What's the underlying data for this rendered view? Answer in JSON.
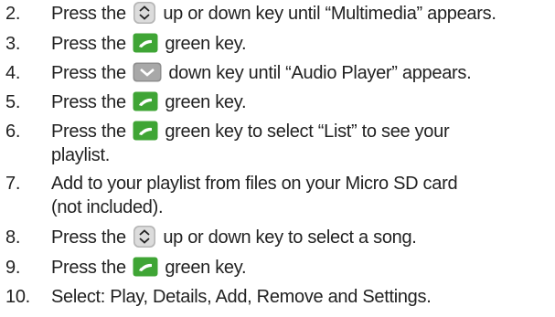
{
  "steps": [
    {
      "num": "2.",
      "before": "Press the",
      "icon": "up-down-key-icon",
      "after": "up or down key until “Multimedia” appears."
    },
    {
      "num": "3.",
      "before": "Press the",
      "icon": "green-key-icon",
      "after": "green key."
    },
    {
      "num": "4.",
      "before": "Press the",
      "icon": "down-key-icon",
      "after": "down key until “Audio Player” appears."
    },
    {
      "num": "5.",
      "before": "Press the",
      "icon": "green-key-icon",
      "after": "green key."
    },
    {
      "num": "6.",
      "before": "Press the",
      "icon": "green-key-icon",
      "after": "green key to select “List” to see your",
      "cont": "playlist."
    },
    {
      "num": "7.",
      "text": "Add to your playlist from files on your Micro SD card",
      "cont": "(not included)."
    },
    {
      "num": "8.",
      "before": "Press the",
      "icon": "up-down-key-icon",
      "after": "up or down key to select a song."
    },
    {
      "num": "9.",
      "before": "Press the",
      "icon": "green-key-icon",
      "after": "green key."
    },
    {
      "num": "10.",
      "text": "Select: Play, Details, Add, Remove and Settings."
    }
  ],
  "colors": {
    "green_key": "#3fa535",
    "key_gray": "#9a9a9a",
    "text": "#222222"
  }
}
